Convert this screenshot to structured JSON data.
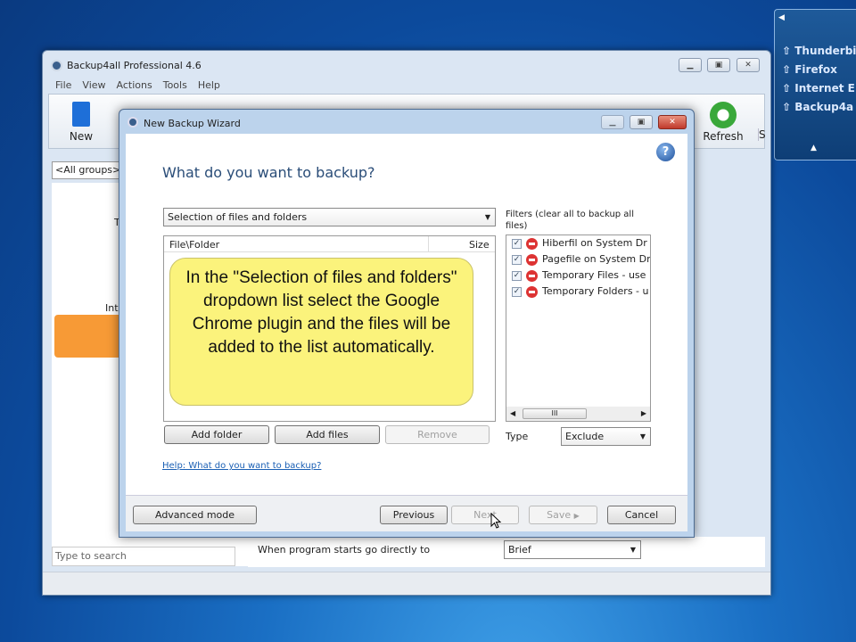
{
  "main_window": {
    "title": "Backup4all Professional 4.6",
    "menu": [
      "File",
      "View",
      "Actions",
      "Tools",
      "Help"
    ],
    "toolbar": {
      "new_label": "New",
      "refresh_label": "Refresh",
      "s_label": "S"
    },
    "groups_select": "<All groups>",
    "left_fragments": [
      "T",
      "Int"
    ],
    "search_placeholder": "Type to search",
    "startup_label": "When program starts go directly to",
    "startup_value": "Brief"
  },
  "dialog": {
    "title": "New Backup Wizard",
    "heading": "What do you want to backup?",
    "source_select": "Selection of files and folders",
    "columns": [
      "File\\Folder",
      "Size"
    ],
    "callout": "In the \"Selection of files and folders\" dropdown list select the Google Chrome plugin and the files will be added to the list automatically.",
    "filters_label": "Filters (clear all to backup all files)",
    "filters": [
      "Hiberfil on System Dr",
      "Pagefile on System Dr",
      "Temporary Files - use",
      "Temporary Folders - u"
    ],
    "scroll_grip": "III",
    "type_label": "Type",
    "type_value": "Exclude",
    "add_folder": "Add folder",
    "add_files": "Add files",
    "remove": "Remove",
    "help_link": "Help: What do you want to backup?",
    "advanced_mode": "Advanced mode",
    "previous": "Previous",
    "next": "Next",
    "save": "Save",
    "cancel": "Cancel"
  },
  "side_panel": {
    "items": [
      "Thunderbird",
      "Firefox",
      "Internet E",
      "Backup4a"
    ]
  }
}
